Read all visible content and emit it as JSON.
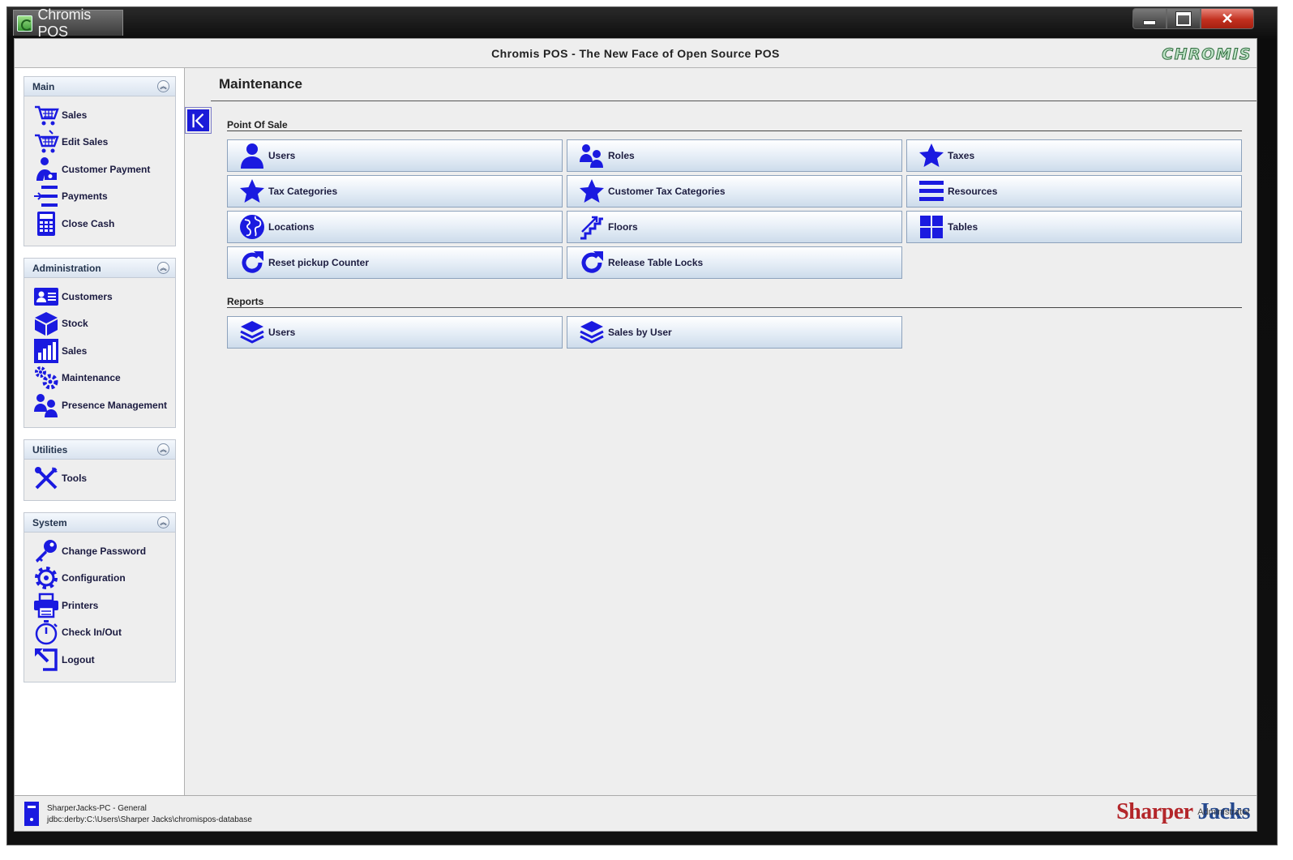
{
  "window": {
    "title": "Chromis POS"
  },
  "header": {
    "title": "Chromis POS - The New Face of Open Source POS",
    "logo": "CHROMIS"
  },
  "sidebar": {
    "panels": [
      {
        "title": "Main",
        "items": [
          {
            "label": "Sales",
            "icon": "cart-icon"
          },
          {
            "label": "Edit Sales",
            "icon": "cart-edit-icon"
          },
          {
            "label": "Customer Payment",
            "icon": "customer-payment-icon"
          },
          {
            "label": "Payments",
            "icon": "payments-icon"
          },
          {
            "label": "Close Cash",
            "icon": "calculator-icon"
          }
        ]
      },
      {
        "title": "Administration",
        "items": [
          {
            "label": "Customers",
            "icon": "address-card-icon"
          },
          {
            "label": "Stock",
            "icon": "cube-icon"
          },
          {
            "label": "Sales",
            "icon": "bar-chart-icon"
          },
          {
            "label": "Maintenance",
            "icon": "gears-icon"
          },
          {
            "label": "Presence Management",
            "icon": "users-icon"
          }
        ]
      },
      {
        "title": "Utilities",
        "items": [
          {
            "label": "Tools",
            "icon": "tools-icon"
          }
        ]
      },
      {
        "title": "System",
        "items": [
          {
            "label": "Change Password",
            "icon": "key-icon"
          },
          {
            "label": "Configuration",
            "icon": "gear-icon"
          },
          {
            "label": "Printers",
            "icon": "printer-icon"
          },
          {
            "label": "Check In/Out",
            "icon": "stopwatch-icon"
          },
          {
            "label": "Logout",
            "icon": "logout-icon"
          }
        ]
      }
    ]
  },
  "main": {
    "title": "Maintenance",
    "sections": [
      {
        "label": "Point Of Sale",
        "tiles": [
          {
            "label": "Users",
            "icon": "user-icon"
          },
          {
            "label": "Roles",
            "icon": "users-icon"
          },
          {
            "label": "Taxes",
            "icon": "star-icon"
          },
          {
            "label": "Tax Categories",
            "icon": "star-icon"
          },
          {
            "label": "Customer Tax Categories",
            "icon": "star-icon"
          },
          {
            "label": "Resources",
            "icon": "list-icon"
          },
          {
            "label": "Locations",
            "icon": "globe-icon"
          },
          {
            "label": "Floors",
            "icon": "stairs-icon"
          },
          {
            "label": "Tables",
            "icon": "grid-icon"
          },
          {
            "label": "Reset pickup Counter",
            "icon": "refresh-icon"
          },
          {
            "label": "Release Table Locks",
            "icon": "refresh-icon"
          }
        ]
      },
      {
        "label": "Reports",
        "tiles": [
          {
            "label": "Users",
            "icon": "layers-icon"
          },
          {
            "label": "Sales by User",
            "icon": "layers-icon"
          }
        ]
      }
    ]
  },
  "status": {
    "host": "SharperJacks-PC - General",
    "database": "jdbc:derby:C:\\Users\\Sharper Jacks\\chromispos-database",
    "user": "Administrator",
    "brand_word1": "Sharper",
    "brand_word2": "Jacks"
  },
  "colors": {
    "icon_blue": "#1a1ae0",
    "tile_border": "#8da2bc"
  }
}
